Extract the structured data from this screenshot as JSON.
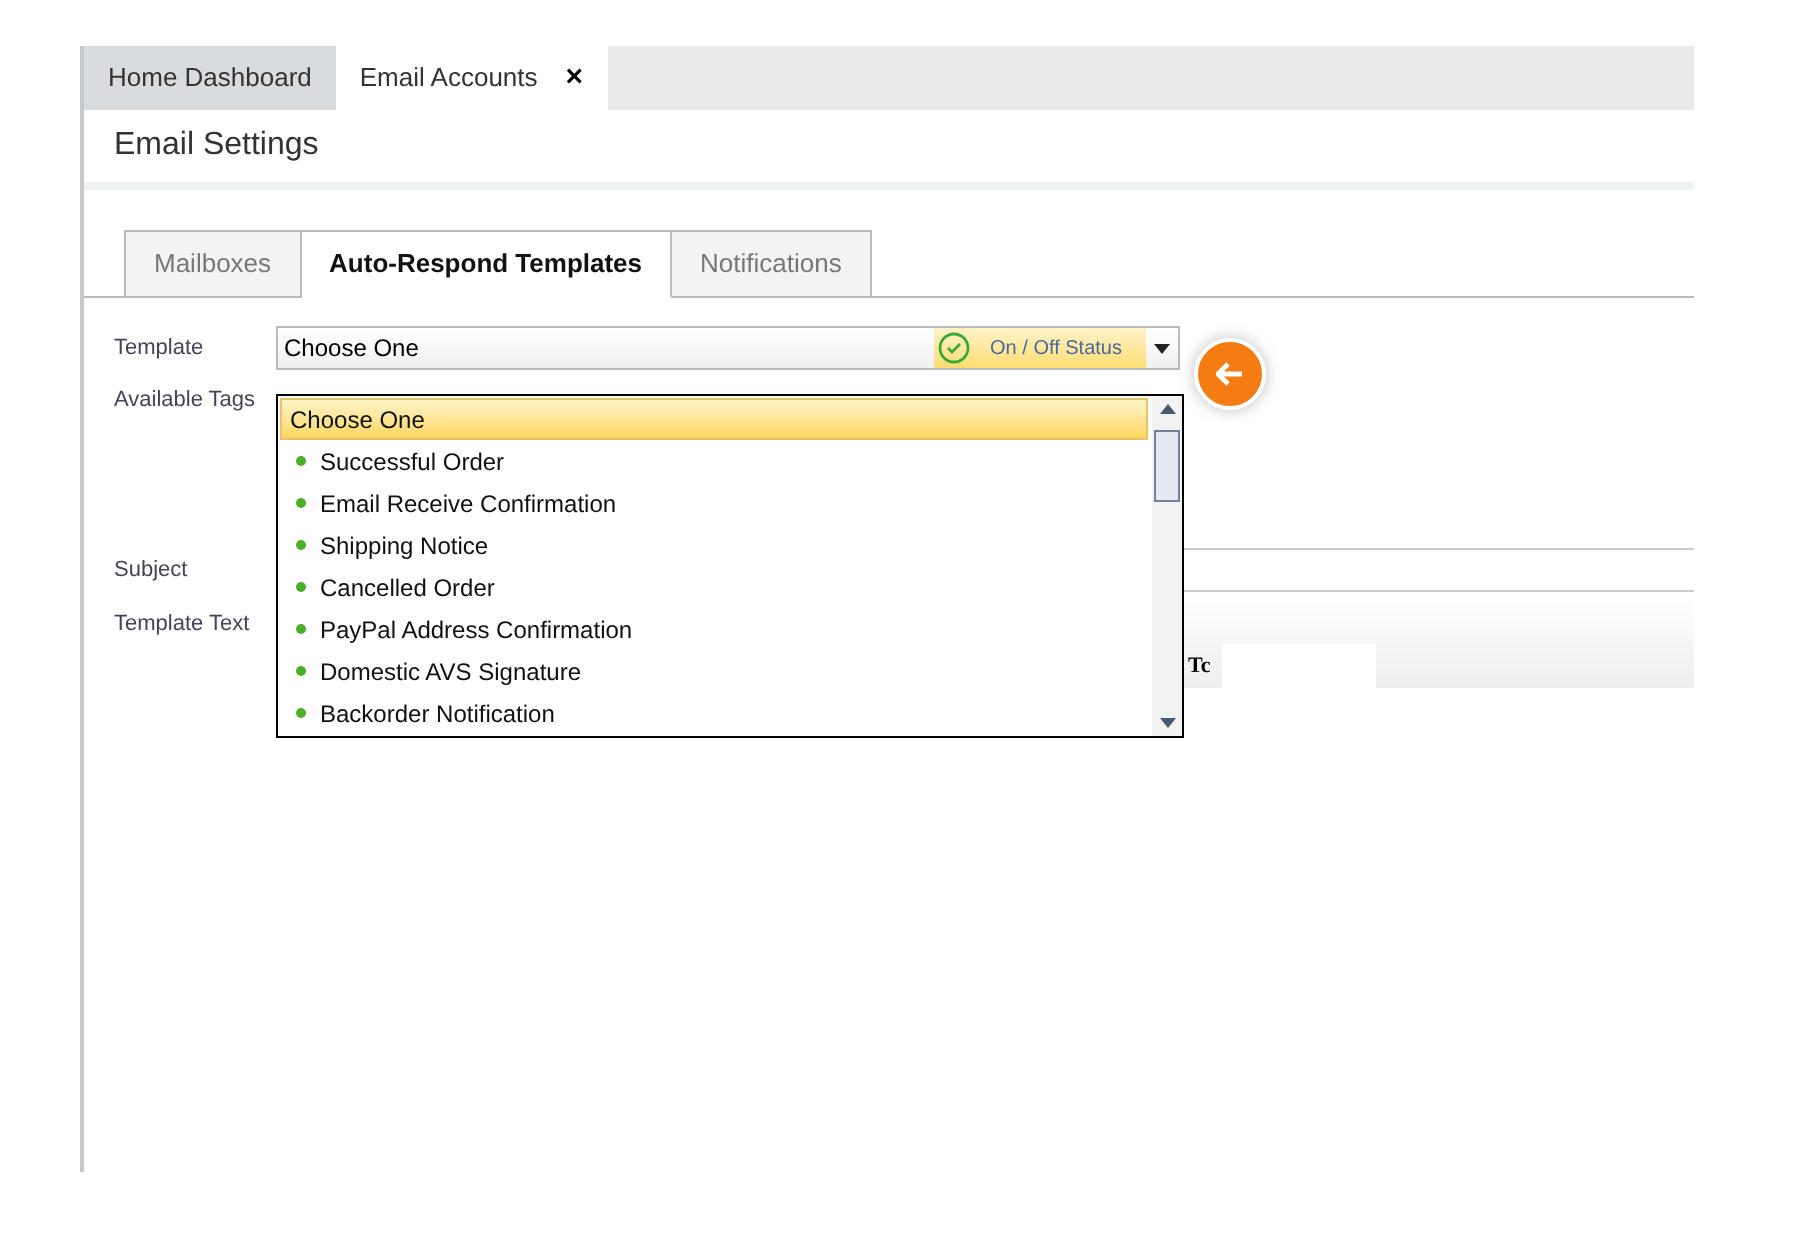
{
  "app_tabs": [
    {
      "label": "Home Dashboard",
      "selected": false,
      "closable": false
    },
    {
      "label": "Email Accounts",
      "selected": true,
      "closable": true,
      "close": "×"
    }
  ],
  "page_title": "Email Settings",
  "section_tabs": [
    {
      "label": "Mailboxes",
      "selected": false
    },
    {
      "label": "Auto-Respond Templates",
      "selected": true
    },
    {
      "label": "Notifications",
      "selected": false
    }
  ],
  "form": {
    "template_label": "Template",
    "template_value": "Choose One",
    "status_label": "On / Off Status",
    "status_on": true,
    "available_tags_label": "Available Tags",
    "subject_label": "Subject",
    "template_text_label": "Template Text",
    "toolbar_text": "Tc"
  },
  "dropdown": {
    "expanded": true,
    "items": [
      {
        "label": "Choose One",
        "selected": true,
        "dot": false
      },
      {
        "label": "Successful Order",
        "selected": false,
        "dot": true
      },
      {
        "label": "Email Receive Confirmation",
        "selected": false,
        "dot": true
      },
      {
        "label": "Shipping Notice",
        "selected": false,
        "dot": true
      },
      {
        "label": "Cancelled Order",
        "selected": false,
        "dot": true
      },
      {
        "label": "PayPal Address Confirmation",
        "selected": false,
        "dot": true
      },
      {
        "label": "Domestic AVS Signature",
        "selected": false,
        "dot": true
      },
      {
        "label": "Backorder Notification",
        "selected": false,
        "dot": true
      }
    ]
  }
}
